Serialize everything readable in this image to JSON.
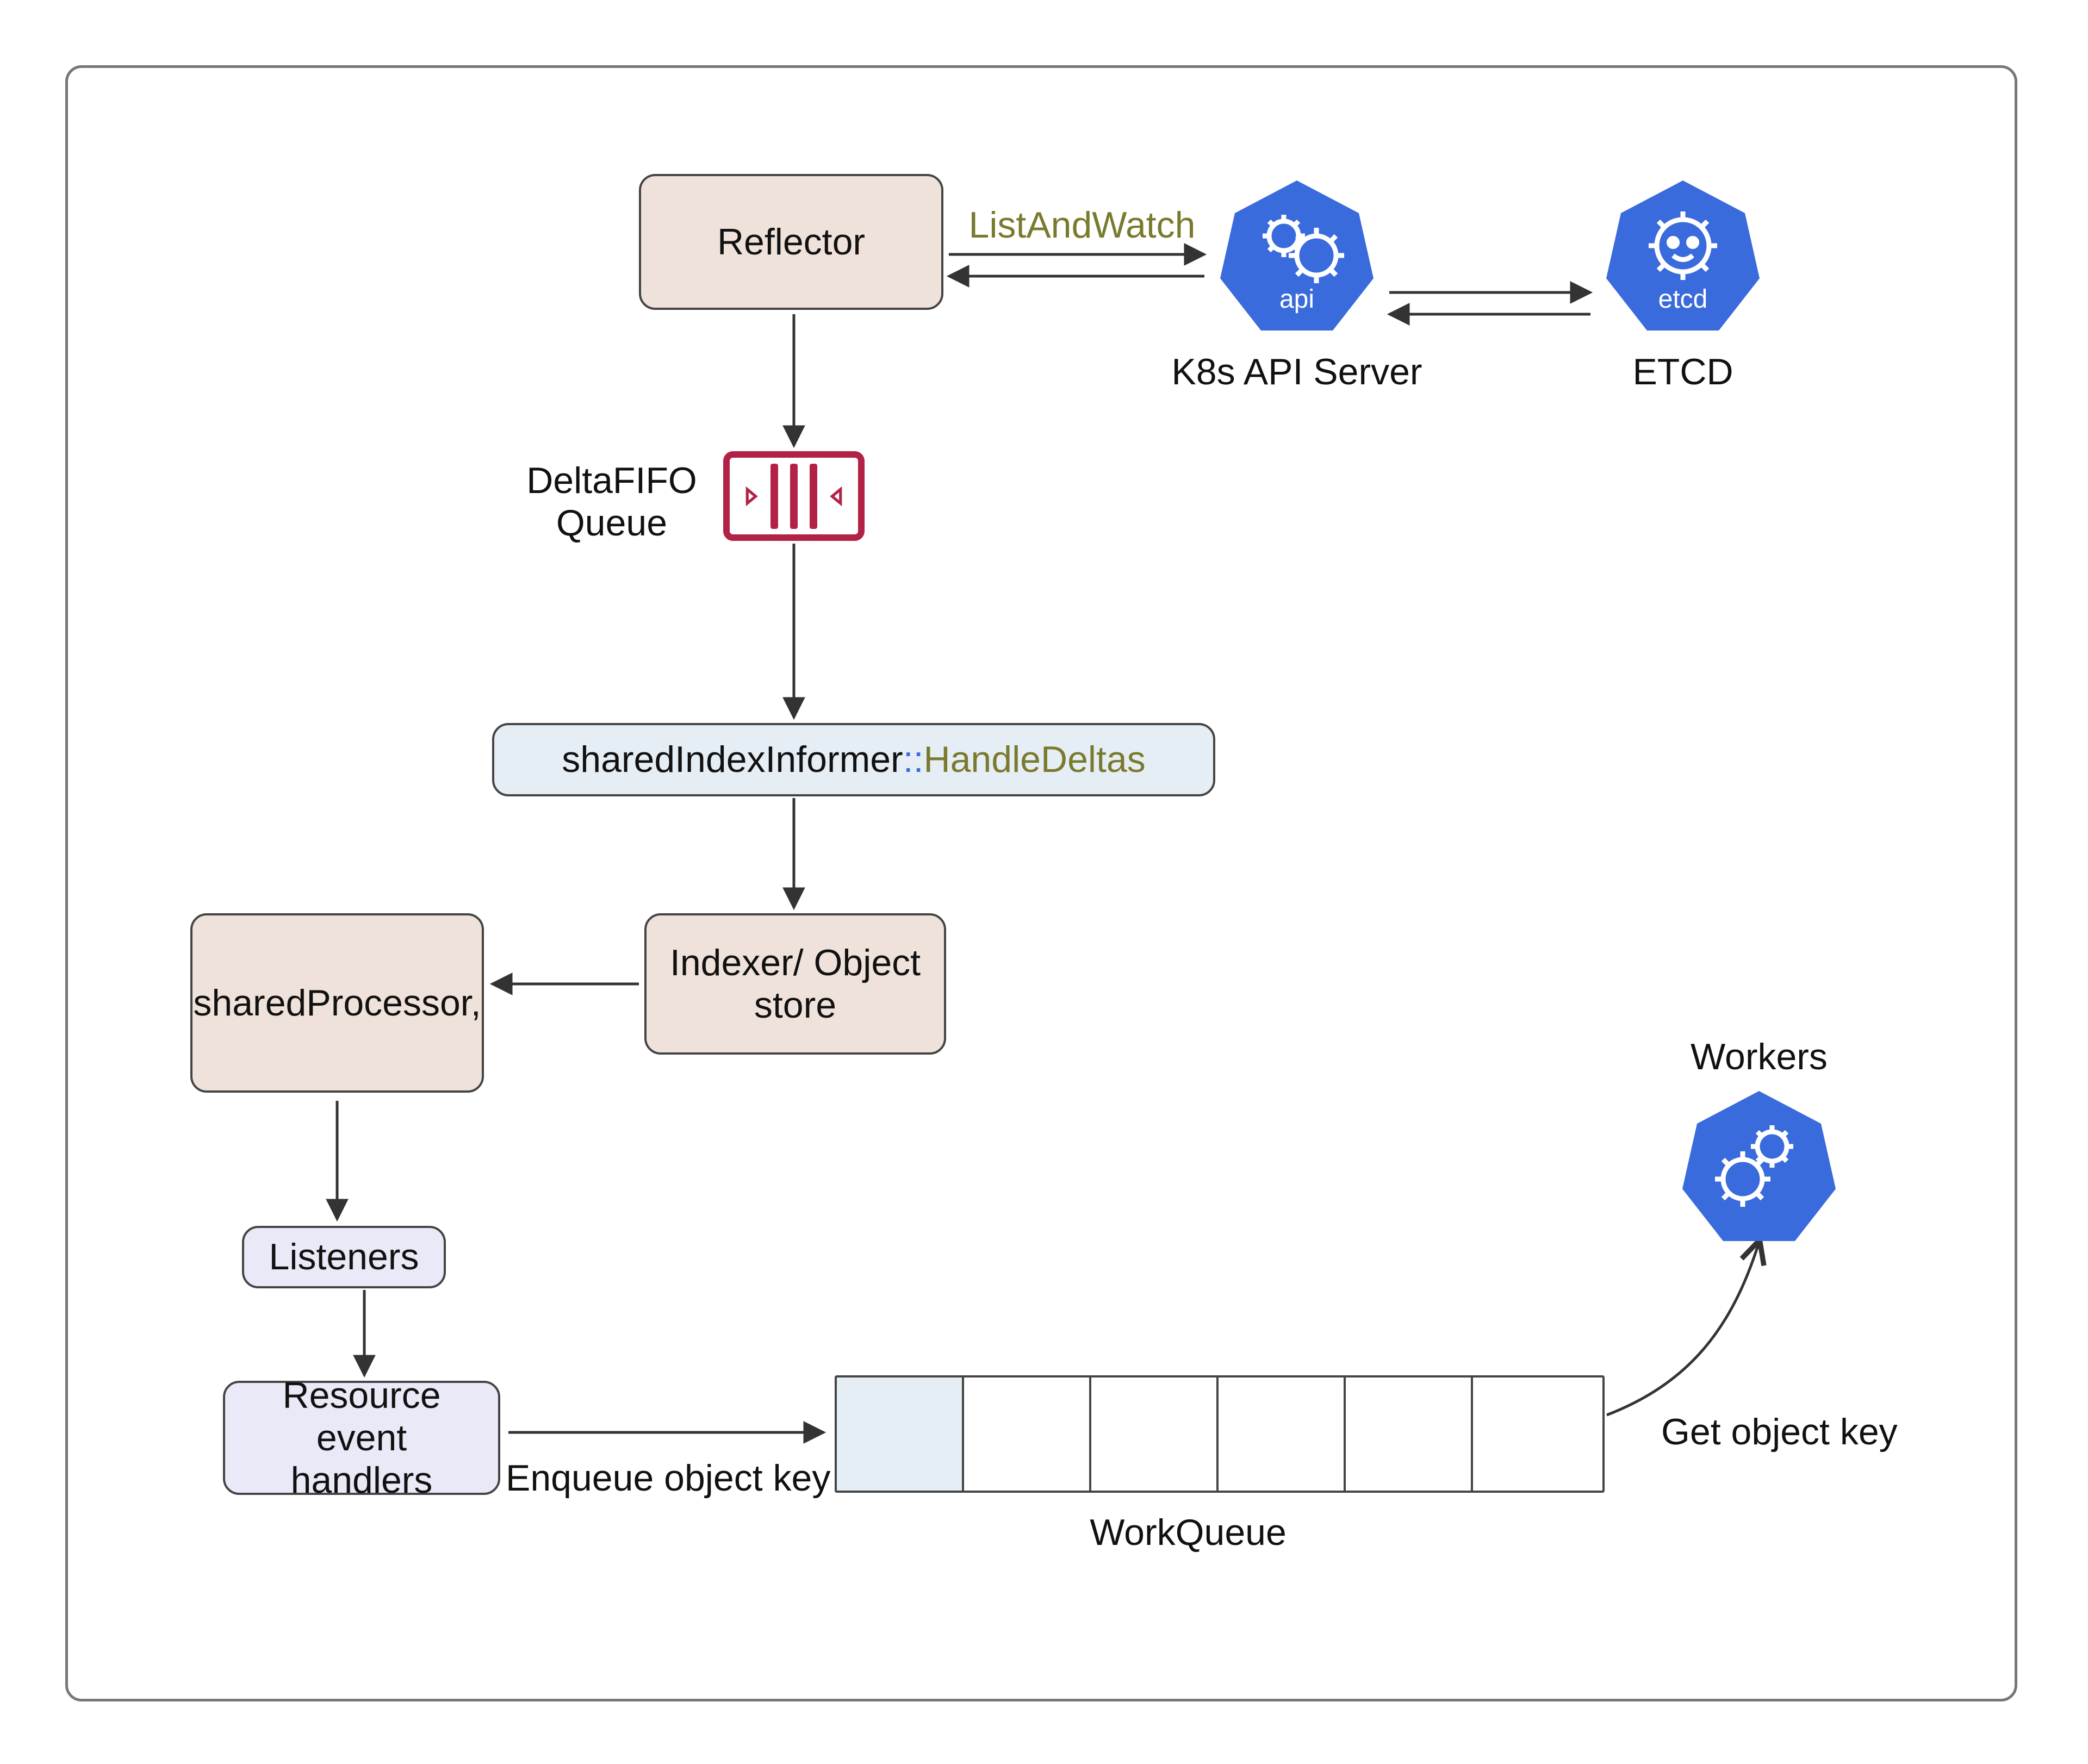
{
  "diagram": {
    "reflector": "Reflector",
    "delta_fifo_label": "DeltaFIFO\nQueue",
    "list_and_watch": "ListAndWatch",
    "k8s_api_server": "K8s API Server",
    "etcd": "ETCD",
    "api_badge": "api",
    "etcd_badge": "etcd",
    "handle_deltas_prefix": "sharedIndexInformer",
    "handle_deltas_sep": "::",
    "handle_deltas_suffix": "HandleDeltas",
    "shared_processor": "sharedProcessor,",
    "indexer": "Indexer/ Object\nstore",
    "listeners": "Listeners",
    "resource_handlers": "Resource event\nhandlers",
    "enqueue": "Enqueue object key",
    "workqueue": "WorkQueue",
    "get_object_key": "Get object key",
    "workers": "Workers"
  },
  "colors": {
    "accent_blue": "#3a6bdc",
    "accent_crimson": "#b22246",
    "olive": "#7a7a2e"
  }
}
